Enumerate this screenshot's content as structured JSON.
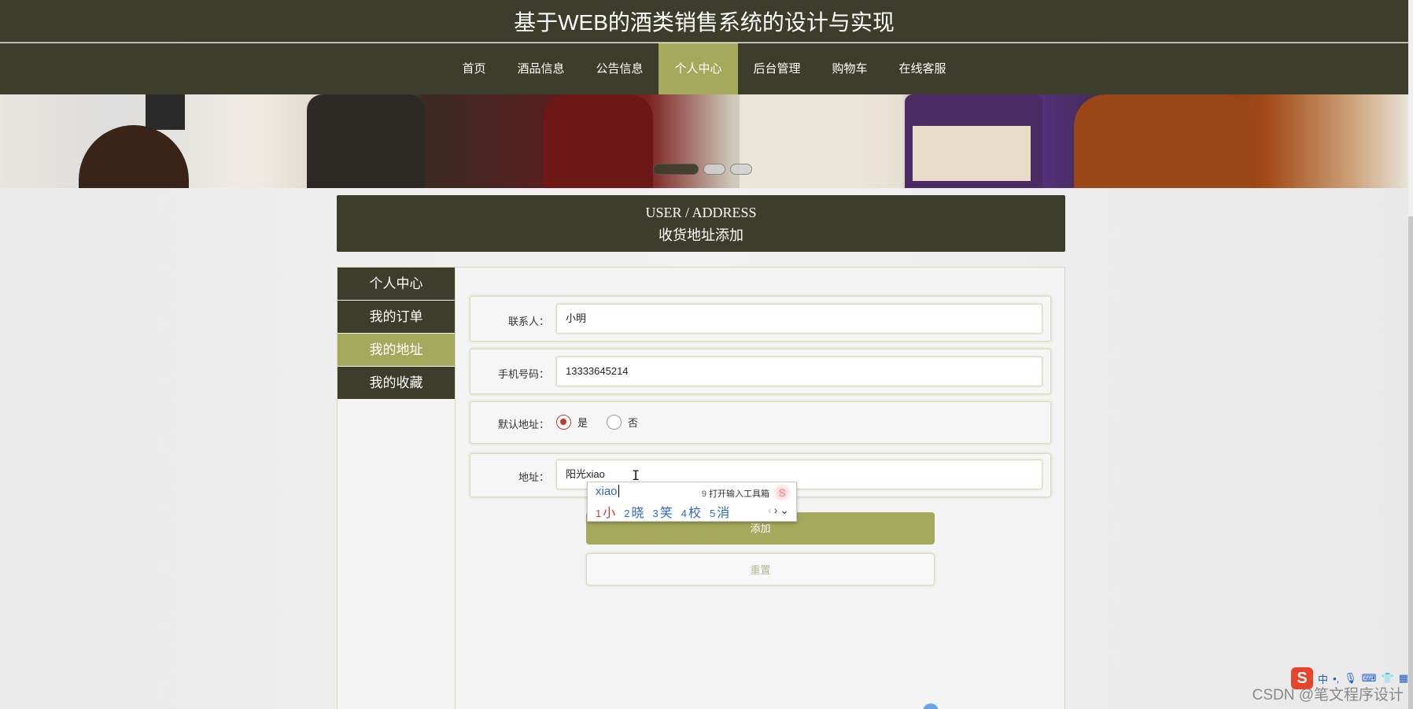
{
  "header": {
    "title": "基于WEB的酒类销售系统的设计与实现"
  },
  "nav": {
    "items": [
      {
        "label": "首页"
      },
      {
        "label": "酒品信息"
      },
      {
        "label": "公告信息"
      },
      {
        "label": "个人中心",
        "active": true
      },
      {
        "label": "后台管理"
      },
      {
        "label": "购物车"
      },
      {
        "label": "在线客服"
      }
    ]
  },
  "section": {
    "en_title": "USER / ADDRESS",
    "cn_title": "收货地址添加"
  },
  "sidebar": {
    "items": [
      {
        "label": "个人中心"
      },
      {
        "label": "我的订单"
      },
      {
        "label": "我的地址",
        "active": true
      },
      {
        "label": "我的收藏"
      }
    ]
  },
  "form": {
    "contact_label": "联系人：",
    "contact_value": "小明",
    "phone_label": "手机号码：",
    "phone_value": "13333645214",
    "default_label": "默认地址：",
    "default_yes": "是",
    "default_no": "否",
    "default_selected": "是",
    "address_label": "地址：",
    "address_value": "阳光xiao",
    "add_button": "添加",
    "reset_button": "重置"
  },
  "ime": {
    "composition": "xiao",
    "toolbox_num": "9",
    "toolbox_label": "打开输入工具箱",
    "candidates": [
      {
        "n": "1",
        "text": "小"
      },
      {
        "n": "2",
        "text": "晓"
      },
      {
        "n": "3",
        "text": "笑"
      },
      {
        "n": "4",
        "text": "校"
      },
      {
        "n": "5",
        "text": "消"
      }
    ]
  },
  "taskbar": {
    "ime_mode": "中",
    "logo": "S"
  },
  "watermark": "CSDN @笔文程序设计",
  "colors": {
    "dark": "#3d3d2c",
    "accent": "#a5a95c",
    "radio_checked": "#c0392b"
  }
}
